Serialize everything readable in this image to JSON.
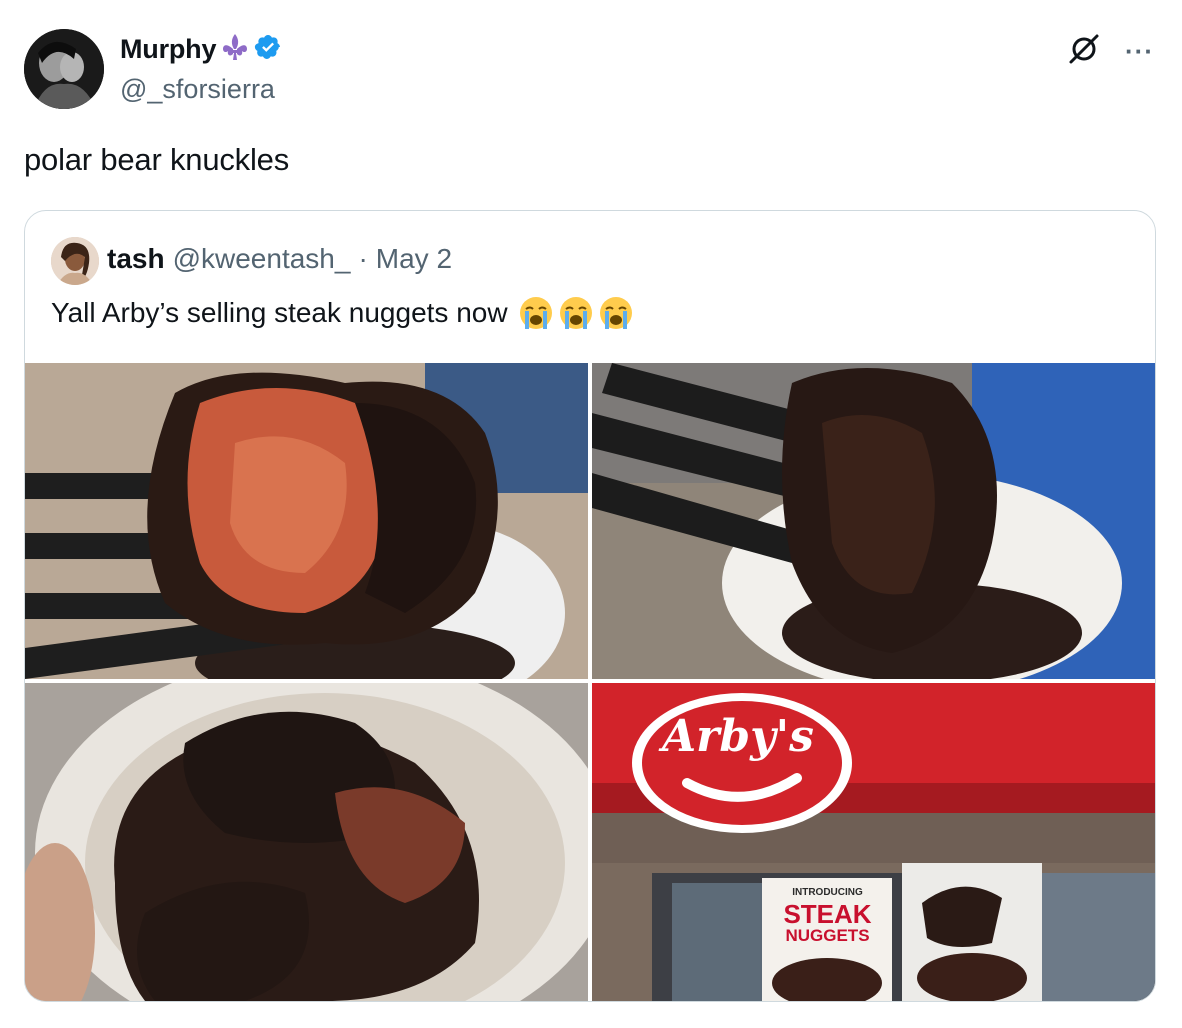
{
  "author": {
    "display_name": "Murphy",
    "emoji": "fleur-de-lis",
    "verified": true,
    "handle": "@_sforsierra"
  },
  "actions": {
    "grok_icon": "slashed-circle-icon",
    "more_label": "···"
  },
  "tweet": {
    "text": "polar bear knuckles"
  },
  "quoted": {
    "name": "tash",
    "handle": "@kweentash_",
    "separator": "·",
    "date": "May 2",
    "text": "Yall Arby’s selling steak nuggets now",
    "emojis": [
      "loudly-crying-face",
      "loudly-crying-face",
      "loudly-crying-face"
    ],
    "media": [
      {
        "name": "steak-nugget-fork-closeup"
      },
      {
        "name": "charred-nugget-on-fork"
      },
      {
        "name": "cup-of-steak-nuggets"
      },
      {
        "name": "arbys-storefront"
      }
    ],
    "storefront": {
      "logo_text": "Arby's",
      "poster_small": "INTRODUCING",
      "poster_line1": "STEAK",
      "poster_line2": "NUGGETS"
    }
  },
  "colors": {
    "verified_blue": "#1d9bf0",
    "fleur_purple": "#8e6bc7",
    "arbys_red": "#d2232a"
  }
}
